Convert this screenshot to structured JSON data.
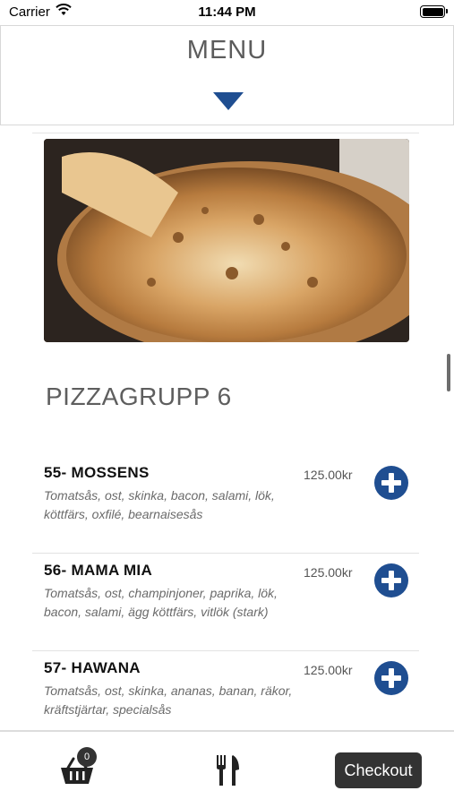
{
  "status_bar": {
    "carrier": "Carrier",
    "time": "11:44 PM"
  },
  "header": {
    "title": "MENU"
  },
  "section": {
    "title": "PIZZAGRUPP 6"
  },
  "items": [
    {
      "name": "55- MOSSENS",
      "description": "Tomatsås, ost, skinka, bacon, salami, lök, köttfärs, oxfilé, bearnaisesås",
      "price": "125.00kr"
    },
    {
      "name": "56- MAMA MIA",
      "description": "Tomatsås, ost, champinjoner, paprika, lök, bacon, salami, ägg köttfärs, vitlök (stark)",
      "price": "125.00kr"
    },
    {
      "name": "57- HAWANA",
      "description": "Tomatsås, ost, skinka, ananas, banan, räkor, kräftstjärtar, specialsås",
      "price": "125.00kr"
    }
  ],
  "tabbar": {
    "cart_count": "0",
    "checkout_label": "Checkout"
  },
  "colors": {
    "accent": "#1f4e91",
    "dark_button": "#333333",
    "title_gray": "#5e5e5e"
  },
  "icons": [
    "wifi-icon",
    "battery-icon",
    "chevron-down-icon",
    "plus-circle-icon",
    "basket-icon",
    "cutlery-icon"
  ]
}
